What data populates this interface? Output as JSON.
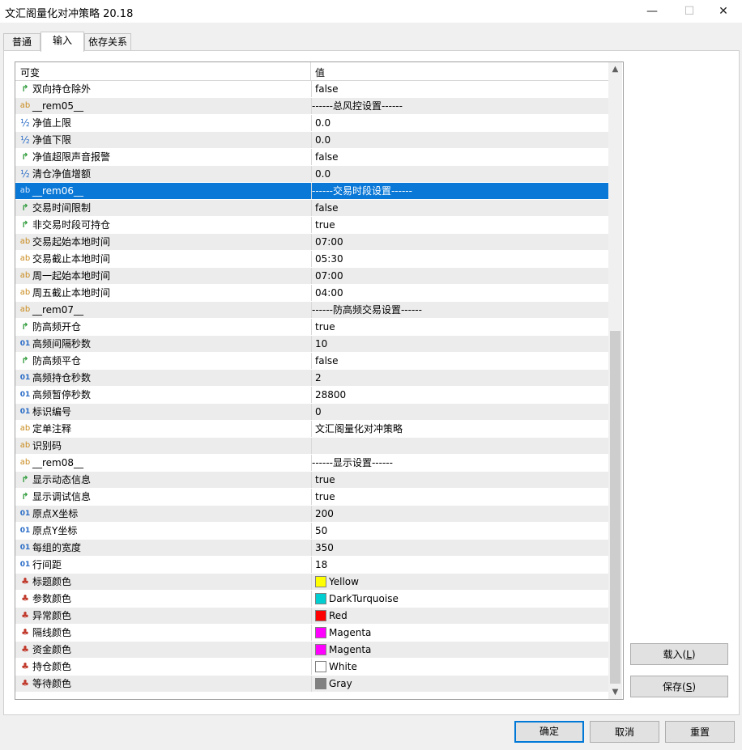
{
  "window": {
    "title": "文汇阁量化对冲策略 20.18",
    "min_glyph": "—",
    "max_glyph": "☐",
    "close_glyph": "✕"
  },
  "tabs": [
    {
      "label": "普通",
      "active": false
    },
    {
      "label": "输入",
      "active": true
    },
    {
      "label": "依存关系",
      "active": false
    }
  ],
  "grid": {
    "header_name": "可变",
    "header_value": "值",
    "rows": [
      {
        "type": "bool",
        "name": "双向持仓除外",
        "value": "false"
      },
      {
        "type": "str",
        "name": "__rem05__",
        "value": "------总风控设置------"
      },
      {
        "type": "dbl",
        "name": "净值上限",
        "value": "0.0"
      },
      {
        "type": "dbl",
        "name": "净值下限",
        "value": "0.0"
      },
      {
        "type": "bool",
        "name": "净值超限声音报警",
        "value": "false"
      },
      {
        "type": "dbl",
        "name": "清仓净值增额",
        "value": "0.0"
      },
      {
        "type": "str",
        "name": "__rem06__",
        "value": "------交易时段设置------",
        "selected": true
      },
      {
        "type": "bool",
        "name": "交易时间限制",
        "value": "false"
      },
      {
        "type": "bool",
        "name": "非交易时段可持仓",
        "value": "true"
      },
      {
        "type": "str",
        "name": "交易起始本地时间",
        "value": "07:00"
      },
      {
        "type": "str",
        "name": "交易截止本地时间",
        "value": "05:30"
      },
      {
        "type": "str",
        "name": "周一起始本地时间",
        "value": "07:00"
      },
      {
        "type": "str",
        "name": "周五截止本地时间",
        "value": "04:00"
      },
      {
        "type": "str",
        "name": "__rem07__",
        "value": "------防高频交易设置------"
      },
      {
        "type": "bool",
        "name": "防高频开仓",
        "value": "true"
      },
      {
        "type": "int",
        "name": "高频间隔秒数",
        "value": "10"
      },
      {
        "type": "bool",
        "name": "防高频平仓",
        "value": "false"
      },
      {
        "type": "int",
        "name": "高频持仓秒数",
        "value": "2"
      },
      {
        "type": "int",
        "name": "高频暂停秒数",
        "value": "28800"
      },
      {
        "type": "int",
        "name": "标识编号",
        "value": "0"
      },
      {
        "type": "str",
        "name": "定单注释",
        "value": "文汇阁量化对冲策略"
      },
      {
        "type": "str",
        "name": "识别码",
        "value": ""
      },
      {
        "type": "str",
        "name": "__rem08__",
        "value": "------显示设置------"
      },
      {
        "type": "bool",
        "name": "显示动态信息",
        "value": "true"
      },
      {
        "type": "bool",
        "name": "显示调试信息",
        "value": "true"
      },
      {
        "type": "int",
        "name": "原点X坐标",
        "value": "200"
      },
      {
        "type": "int",
        "name": "原点Y坐标",
        "value": "50"
      },
      {
        "type": "int",
        "name": "每组的宽度",
        "value": "350"
      },
      {
        "type": "int",
        "name": "行间距",
        "value": "18"
      },
      {
        "type": "color",
        "name": "标题颜色",
        "value": "Yellow",
        "swatch": "#ffff00"
      },
      {
        "type": "color",
        "name": "参数颜色",
        "value": "DarkTurquoise",
        "swatch": "#00ced1"
      },
      {
        "type": "color",
        "name": "异常颜色",
        "value": "Red",
        "swatch": "#ff0000"
      },
      {
        "type": "color",
        "name": "隔线颜色",
        "value": "Magenta",
        "swatch": "#ff00ff"
      },
      {
        "type": "color",
        "name": "资金颜色",
        "value": "Magenta",
        "swatch": "#ff00ff"
      },
      {
        "type": "color",
        "name": "持仓颜色",
        "value": "White",
        "swatch": "#ffffff"
      },
      {
        "type": "color",
        "name": "等待颜色",
        "value": "Gray",
        "swatch": "#808080"
      }
    ]
  },
  "icons": {
    "bool": "↱",
    "str": "ab",
    "dbl": "½",
    "int": "01",
    "color": "♣"
  },
  "side_buttons": {
    "load": {
      "text": "载入(",
      "mnemonic": "L",
      "close": ")"
    },
    "save": {
      "text": "保存(",
      "mnemonic": "S",
      "close": ")"
    }
  },
  "footer": {
    "ok": "确定",
    "cancel": "取消",
    "reset": "重置"
  },
  "scrollbar": {
    "up": "▲",
    "down": "▼"
  },
  "colors": {
    "selection": "#0a78d7",
    "default_button_border": "#0078d7"
  }
}
